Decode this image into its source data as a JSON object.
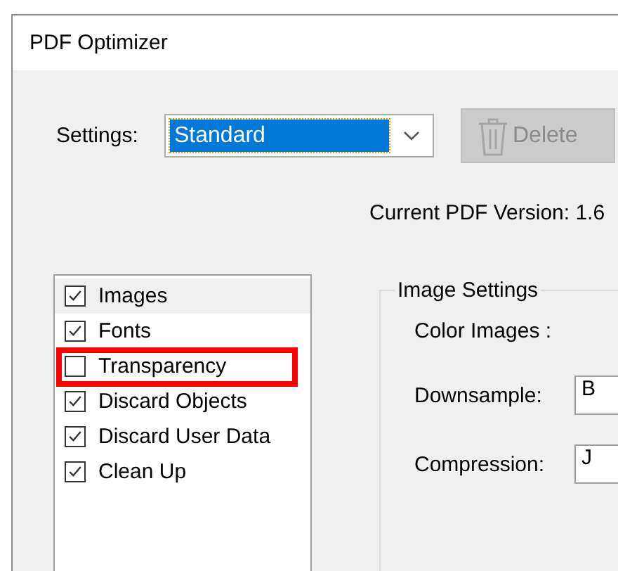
{
  "window": {
    "title": "PDF Optimizer"
  },
  "settings": {
    "label": "Settings:",
    "value": "Standard"
  },
  "delete_button": {
    "label": "Delete",
    "disabled": true
  },
  "pdf_version": "Current PDF Version: 1.6",
  "panels": [
    {
      "label": "Images",
      "checked": true,
      "selected": true,
      "highlighted": false
    },
    {
      "label": "Fonts",
      "checked": true,
      "selected": false,
      "highlighted": false
    },
    {
      "label": "Transparency",
      "checked": false,
      "selected": false,
      "highlighted": true
    },
    {
      "label": "Discard Objects",
      "checked": true,
      "selected": false,
      "highlighted": false
    },
    {
      "label": "Discard User Data",
      "checked": true,
      "selected": false,
      "highlighted": false
    },
    {
      "label": "Clean Up",
      "checked": true,
      "selected": false,
      "highlighted": false
    }
  ],
  "image_settings": {
    "title": "Image Settings",
    "heading": "Color Images :",
    "fields": [
      {
        "label": "Downsample:",
        "value": "B"
      },
      {
        "label": "Compression:",
        "value": "J"
      }
    ]
  }
}
